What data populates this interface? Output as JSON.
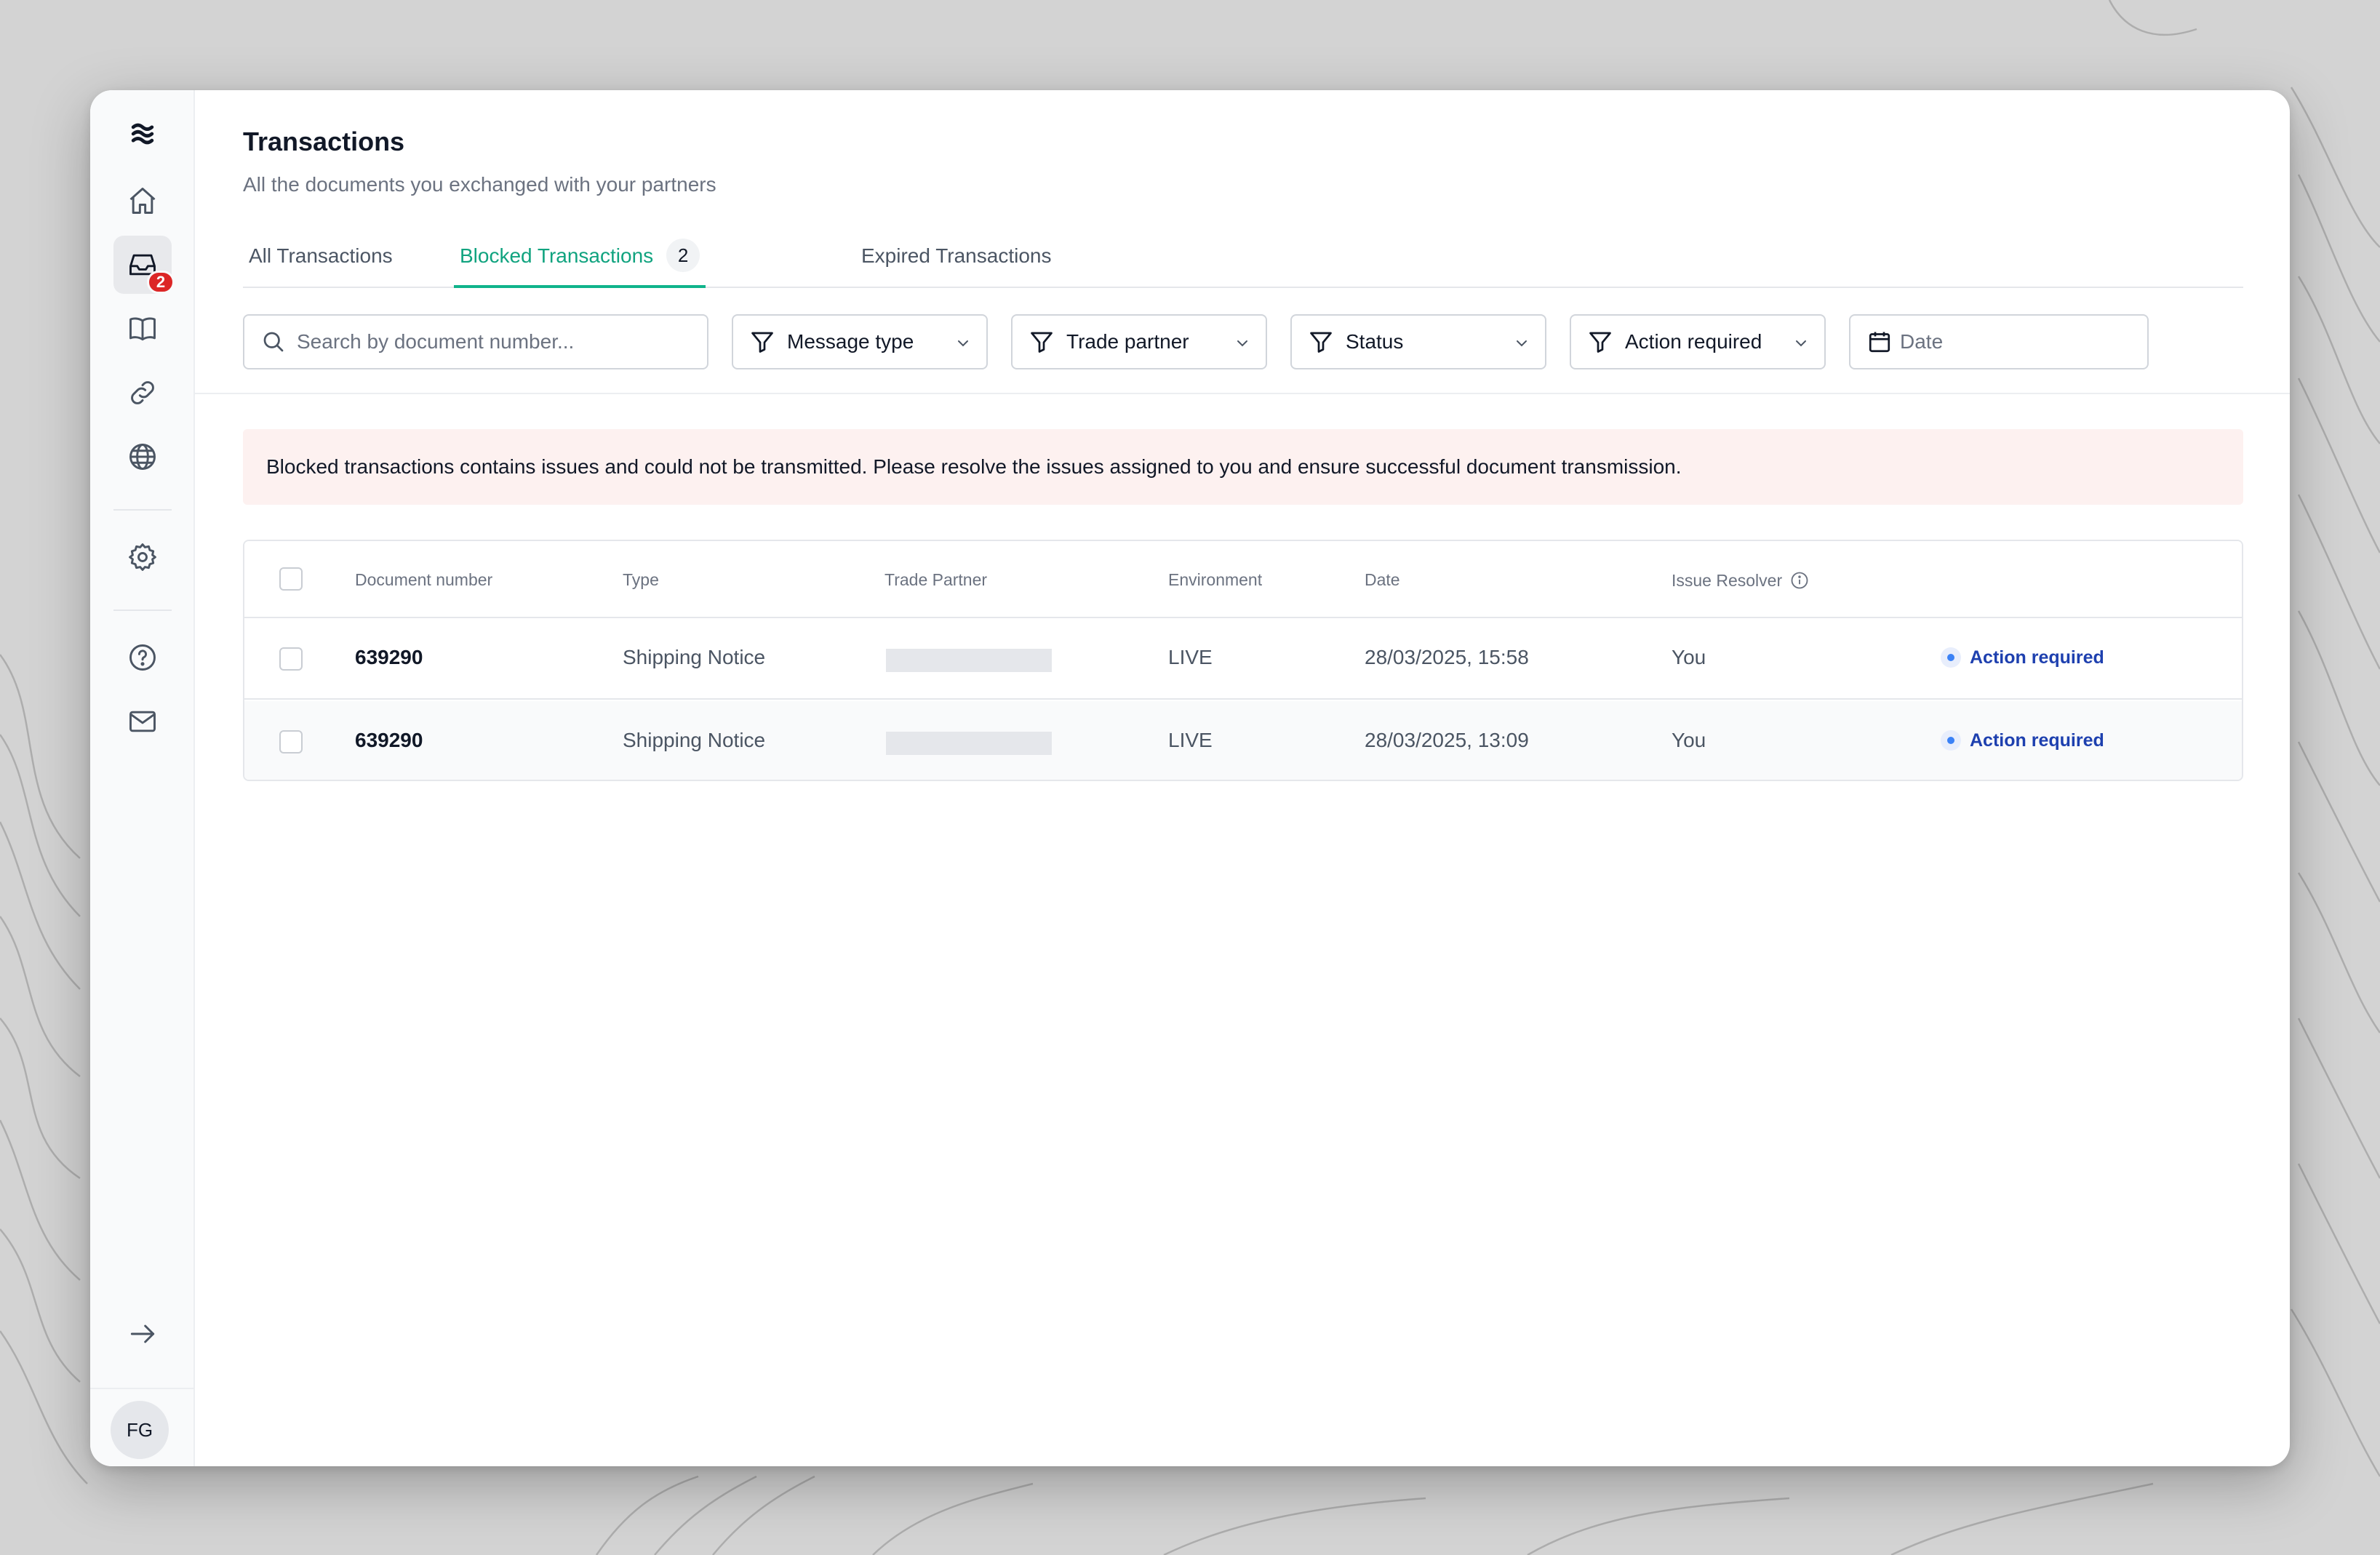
{
  "page": {
    "title": "Transactions",
    "subtitle": "All the documents you exchanged with your partners"
  },
  "sidebar": {
    "inbox_badge": "2",
    "user_initials": "FG"
  },
  "tabs": [
    {
      "label": "All Transactions"
    },
    {
      "label": "Blocked Transactions",
      "count": "2"
    },
    {
      "label": "Expired Transactions"
    }
  ],
  "filters": {
    "search_placeholder": "Search by document number...",
    "message_type": "Message type",
    "trade_partner": "Trade partner",
    "status": "Status",
    "action_required": "Action required",
    "date_placeholder": "Date"
  },
  "alert": {
    "text": "Blocked transactions contains issues and could not be transmitted. Please resolve the issues assigned to you and ensure successful document transmission."
  },
  "table": {
    "columns": [
      "Document number",
      "Type",
      "Trade Partner",
      "Environment",
      "Date",
      "Issue Resolver"
    ],
    "rows": [
      {
        "document_number": "639290",
        "type": "Shipping Notice",
        "environment": "LIVE",
        "date": "28/03/2025, 15:58",
        "resolver": "You",
        "status": "Action required"
      },
      {
        "document_number": "639290",
        "type": "Shipping Notice",
        "environment": "LIVE",
        "date": "28/03/2025, 13:09",
        "resolver": "You",
        "status": "Action required"
      }
    ]
  },
  "colors": {
    "accent": "#10a37f",
    "badge": "#dc2626",
    "alert_bg": "#fdf1f0",
    "status_text": "#1e40af"
  }
}
